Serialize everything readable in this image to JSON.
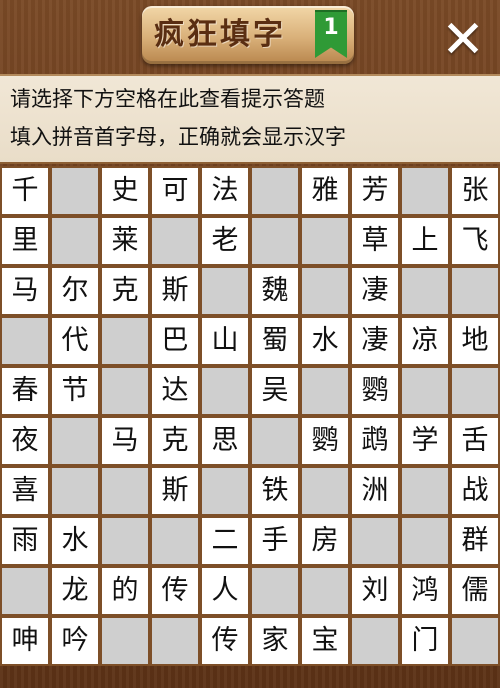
{
  "header": {
    "title": "疯狂填字",
    "level": "1",
    "close_icon": "close-icon"
  },
  "hint_panel": {
    "line1": "请选择下方空格在此查看提示答题",
    "line2": "填入拼音首字母，正确就会显示汉字"
  },
  "colors": {
    "filled_cell": "#ffffff",
    "empty_cell": "#cfcfcf",
    "grid_border": "#7d4f28",
    "level_badge": "#2f9a36"
  },
  "grid": {
    "rows": 10,
    "cols": 10,
    "cells": [
      [
        "千",
        "",
        "史",
        "可",
        "法",
        "",
        "雅",
        "芳",
        "",
        "张"
      ],
      [
        "里",
        "",
        "莱",
        "",
        "老",
        "",
        "",
        "草",
        "上",
        "飞"
      ],
      [
        "马",
        "尔",
        "克",
        "斯",
        "",
        "魏",
        "",
        "凄",
        "",
        ""
      ],
      [
        "",
        "代",
        "",
        "巴",
        "山",
        "蜀",
        "水",
        "凄",
        "凉",
        "地"
      ],
      [
        "春",
        "节",
        "",
        "达",
        "",
        "吴",
        "",
        "鹦",
        "",
        ""
      ],
      [
        "夜",
        "",
        "马",
        "克",
        "思",
        "",
        "鹦",
        "鹉",
        "学",
        "舌"
      ],
      [
        "喜",
        "",
        "",
        "斯",
        "",
        "铁",
        "",
        "洲",
        "",
        "战"
      ],
      [
        "雨",
        "水",
        "",
        "",
        "二",
        "手",
        "房",
        "",
        "",
        "群"
      ],
      [
        "",
        "龙",
        "的",
        "传",
        "人",
        "",
        "",
        "刘",
        "鸿",
        "儒"
      ],
      [
        "呻",
        "吟",
        "",
        "",
        "传",
        "家",
        "宝",
        "",
        "门",
        ""
      ]
    ],
    "blank_cells": [
      [
        0,
        1
      ],
      [
        0,
        5
      ],
      [
        0,
        8
      ],
      [
        1,
        1
      ],
      [
        1,
        3
      ],
      [
        1,
        5
      ],
      [
        1,
        6
      ],
      [
        2,
        4
      ],
      [
        2,
        6
      ],
      [
        2,
        8
      ],
      [
        2,
        9
      ],
      [
        3,
        0
      ],
      [
        3,
        2
      ],
      [
        4,
        2
      ],
      [
        4,
        4
      ],
      [
        4,
        6
      ],
      [
        4,
        8
      ],
      [
        4,
        9
      ],
      [
        5,
        1
      ],
      [
        5,
        5
      ],
      [
        6,
        1
      ],
      [
        6,
        2
      ],
      [
        6,
        4
      ],
      [
        6,
        6
      ],
      [
        6,
        8
      ],
      [
        7,
        2
      ],
      [
        7,
        3
      ],
      [
        7,
        7
      ],
      [
        7,
        8
      ],
      [
        8,
        0
      ],
      [
        8,
        5
      ],
      [
        8,
        6
      ],
      [
        9,
        2
      ],
      [
        9,
        3
      ],
      [
        9,
        7
      ],
      [
        9,
        9
      ]
    ]
  }
}
